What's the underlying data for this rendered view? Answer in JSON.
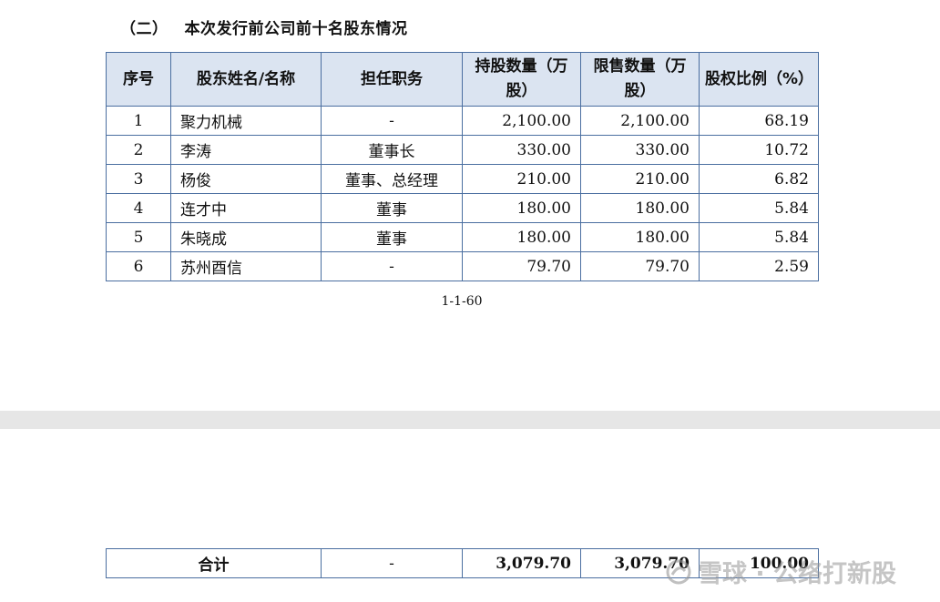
{
  "section": {
    "number": "（二）",
    "title": "本次发行前公司前十名股东情况"
  },
  "table": {
    "headers": [
      "序号",
      "股东姓名/名称",
      "担任职务",
      "持股数量（万股）",
      "限售数量（万股）",
      "股权比例（%）"
    ],
    "rows": [
      [
        "1",
        "聚力机械",
        "-",
        "2,100.00",
        "2,100.00",
        "68.19"
      ],
      [
        "2",
        "李涛",
        "董事长",
        "330.00",
        "330.00",
        "10.72"
      ],
      [
        "3",
        "杨俊",
        "董事、总经理",
        "210.00",
        "210.00",
        "6.82"
      ],
      [
        "4",
        "连才中",
        "董事",
        "180.00",
        "180.00",
        "5.84"
      ],
      [
        "5",
        "朱晓成",
        "董事",
        "180.00",
        "180.00",
        "5.84"
      ],
      [
        "6",
        "苏州酉信",
        "-",
        "79.70",
        "79.70",
        "2.59"
      ]
    ]
  },
  "page_number": "1-1-60",
  "total_row": [
    "合计",
    "-",
    "3,079.70",
    "3,079.70",
    "100.00"
  ],
  "watermark": {
    "text": "雪球 · 公络打新股",
    "icon": "snowball-logo-icon"
  }
}
